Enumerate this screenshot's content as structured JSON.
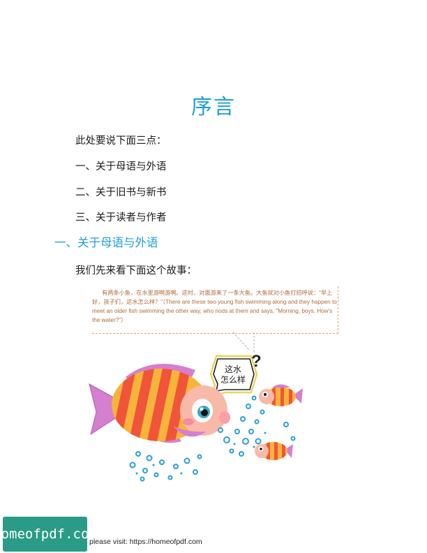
{
  "title": "序言",
  "intro": "此处要说下面三点：",
  "points": [
    "一、关于母语与外语",
    "二、关于旧书与新书",
    "三、关于读者与作者"
  ],
  "section_heading": "一、关于母语与外语",
  "section_intro": "我们先来看下面这个故事：",
  "story_text": "有两条小鱼，在水里游啊游啊。这时，对面游来了一条大鱼。大鱼就对小鱼打招呼说：“早上好，孩子们，这水怎么样？”（There are these two young fish swimming along and they happen to meet an older fish swimming the other way, who nods at them and says, \"Morning, boys. How's the water?\"）",
  "speech_line1": "这水",
  "speech_line2": "怎么样",
  "question_mark": "?",
  "badge_text": "homeofpdf.com",
  "footer_text": "please visit: https://homeofpdf.com"
}
